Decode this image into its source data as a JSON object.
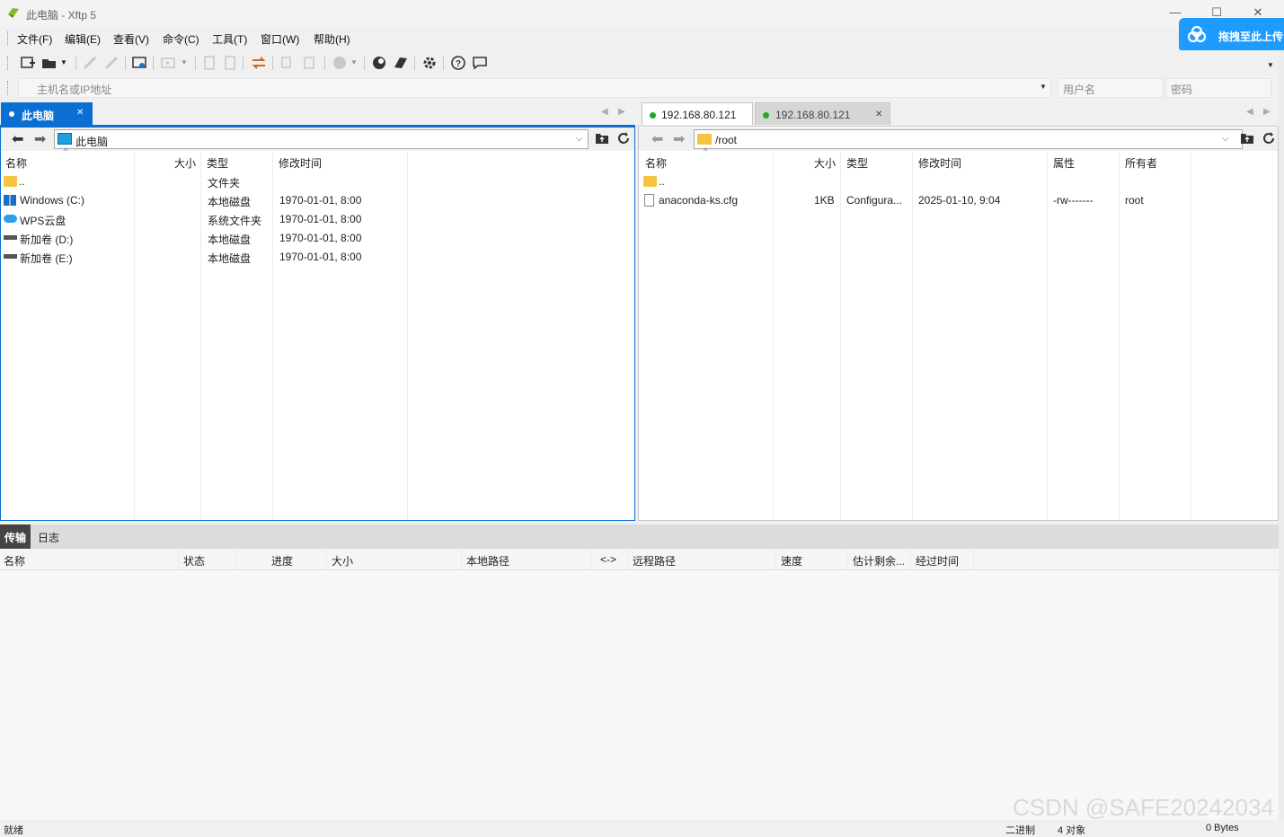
{
  "window": {
    "title": "此电脑 - Xftp 5",
    "minimize": "—",
    "maximize": "☐",
    "close": "✕"
  },
  "menu": [
    "文件(F)",
    "编辑(E)",
    "查看(V)",
    "命令(C)",
    "工具(T)",
    "窗口(W)",
    "帮助(H)"
  ],
  "baidu_upload": {
    "label": "拖拽至此上传",
    "color": "#1e9bff"
  },
  "address": {
    "host_placeholder": "主机名或IP地址",
    "user_placeholder": "用户名",
    "password_placeholder": "密码"
  },
  "left": {
    "tab_label": "此电脑",
    "path": "此电脑",
    "columns": [
      "名称",
      "大小",
      "类型",
      "修改时间"
    ],
    "rows": [
      {
        "icon": "folder-icon",
        "name": "..",
        "size": "",
        "type": "文件夹",
        "modified": ""
      },
      {
        "icon": "windows-drive-icon",
        "name": "Windows (C:)",
        "size": "",
        "type": "本地磁盘",
        "modified": "1970-01-01, 8:00"
      },
      {
        "icon": "cloud-drive-icon",
        "name": "WPS云盘",
        "size": "",
        "type": "系统文件夹",
        "modified": "1970-01-01, 8:00"
      },
      {
        "icon": "drive-icon",
        "name": "新加卷 (D:)",
        "size": "",
        "type": "本地磁盘",
        "modified": "1970-01-01, 8:00"
      },
      {
        "icon": "drive-icon",
        "name": "新加卷 (E:)",
        "size": "",
        "type": "本地磁盘",
        "modified": "1970-01-01, 8:00"
      }
    ]
  },
  "right": {
    "tabs": [
      {
        "label": "192.168.80.121",
        "status_color": "#22aa22",
        "active": true
      },
      {
        "label": "192.168.80.121",
        "status_color": "#22aa22",
        "active": false
      }
    ],
    "path": "/root",
    "columns": [
      "名称",
      "大小",
      "类型",
      "修改时间",
      "属性",
      "所有者"
    ],
    "rows": [
      {
        "icon": "folder-icon",
        "name": "..",
        "size": "",
        "type": "",
        "modified": "",
        "attrs": "",
        "owner": ""
      },
      {
        "icon": "file-icon",
        "name": "anaconda-ks.cfg",
        "size": "1KB",
        "type": "Configura...",
        "modified": "2025-01-10, 9:04",
        "attrs": "-rw-------",
        "owner": "root"
      }
    ]
  },
  "bottom": {
    "tabs": [
      "传输",
      "日志"
    ],
    "columns": [
      "名称",
      "状态",
      "进度",
      "大小",
      "本地路径",
      "<->",
      "远程路径",
      "速度",
      "估计剩余...",
      "经过时间"
    ]
  },
  "status": {
    "left": "就绪",
    "mode": "二进制",
    "objects": "4 对象",
    "bytes": "0 Bytes"
  },
  "watermark": "CSDN @SAFE20242034"
}
